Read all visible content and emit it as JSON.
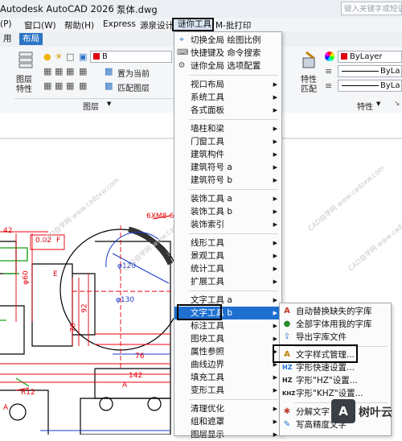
{
  "titlebar": {
    "app": "Autodesk AutoCAD 2026",
    "file": "泵体.dwg",
    "search_placeholder": "键入关键字或短语"
  },
  "menubar": {
    "items": [
      "(P)",
      "窗口(W)",
      "帮助(H)",
      "Express",
      "源泉设计",
      "谜你工具",
      "M-批打印"
    ],
    "active": "谜你工具"
  },
  "tabs": [
    "用",
    "布局"
  ],
  "tab_selected": "布局",
  "ribbon": {
    "layer_props": "图层\n特性",
    "layer_combo": "B",
    "set_current": "置为当前",
    "match_layer": "匹配图层",
    "layers_panel": "图层",
    "match_props": "特性\n匹配",
    "bylayer1": "ByLayer",
    "bylayer2": "ByLa",
    "bylayer3": "ByLa",
    "properties_panel": "特性"
  },
  "main_menu": {
    "items": [
      {
        "icon": "scale-icon",
        "label": "切换全局 绘图比例"
      },
      {
        "icon": "keyboard-icon",
        "label": "快捷键及 命令搜索"
      },
      {
        "icon": "gear-icon",
        "label": "谜你全局 选项配置"
      },
      {
        "label": "视口布局",
        "sub": true
      },
      {
        "label": "系统工具",
        "sub": true
      },
      {
        "label": "各式面板",
        "sub": true
      },
      {
        "label": "墙柱和梁",
        "sub": true
      },
      {
        "label": "门窗工具",
        "sub": true
      },
      {
        "label": "建筑构件",
        "sub": true
      },
      {
        "label": "建筑符号 a",
        "sub": true
      },
      {
        "label": "建筑符号 b",
        "sub": true
      },
      {
        "label": "装饰工具 a",
        "sub": true
      },
      {
        "label": "装饰工具 b",
        "sub": true
      },
      {
        "label": "装饰索引",
        "sub": true
      },
      {
        "label": "线形工具",
        "sub": true
      },
      {
        "label": "景观工具",
        "sub": true
      },
      {
        "label": "统计工具",
        "sub": true
      },
      {
        "label": "扩展工具",
        "sub": true
      },
      {
        "label": "文字工具 a",
        "sub": true
      },
      {
        "label": "文字工具 b",
        "sub": true
      },
      {
        "label": "标注工具",
        "sub": true
      },
      {
        "label": "图块工具",
        "sub": true
      },
      {
        "label": "属性参照",
        "sub": true
      },
      {
        "label": "曲线边界",
        "sub": true
      },
      {
        "label": "填充工具",
        "sub": true
      },
      {
        "label": "变形工具",
        "sub": true
      },
      {
        "label": "清理优化",
        "sub": true
      },
      {
        "label": "组和遮罩",
        "sub": true
      },
      {
        "label": "图层显示",
        "sub": true
      }
    ]
  },
  "sub_menu": {
    "items": [
      {
        "icon": "font-replace-icon",
        "label": "自动替换缺失的字库"
      },
      {
        "icon": "font-all-icon",
        "label": "全部字体用我的字库"
      },
      {
        "icon": "font-export-icon",
        "label": "导出字库文件"
      },
      {
        "icon": "text-style-icon",
        "label": "文字样式管理..."
      },
      {
        "icon": "hz-quick-icon",
        "label": "字形快速设置..."
      },
      {
        "icon": "hz-icon",
        "label": "字形\"HZ\"设置..."
      },
      {
        "icon": "khz-icon",
        "label": "字形\"KHZ\"设置..."
      },
      {
        "icon": "explode-text-icon",
        "label": "分解文字"
      },
      {
        "icon": "write-text-icon",
        "label": "写高精度文字"
      }
    ]
  },
  "drawing": {
    "dims": [
      "42",
      "0.02",
      "F",
      "6XM8-6H",
      "φ120",
      "φ60",
      "φ130",
      "E",
      "76",
      "142",
      "R12",
      "A",
      "A",
      "92",
      "70"
    ],
    "watermark": "CAD自学网 www.cadzxw.com"
  },
  "logo": {
    "text": "树叶云"
  },
  "colors": {
    "accent": "#1f6fd0",
    "dim_red": "#e8000a",
    "dim_green": "#10a010",
    "dim_blue": "#1838c8"
  }
}
